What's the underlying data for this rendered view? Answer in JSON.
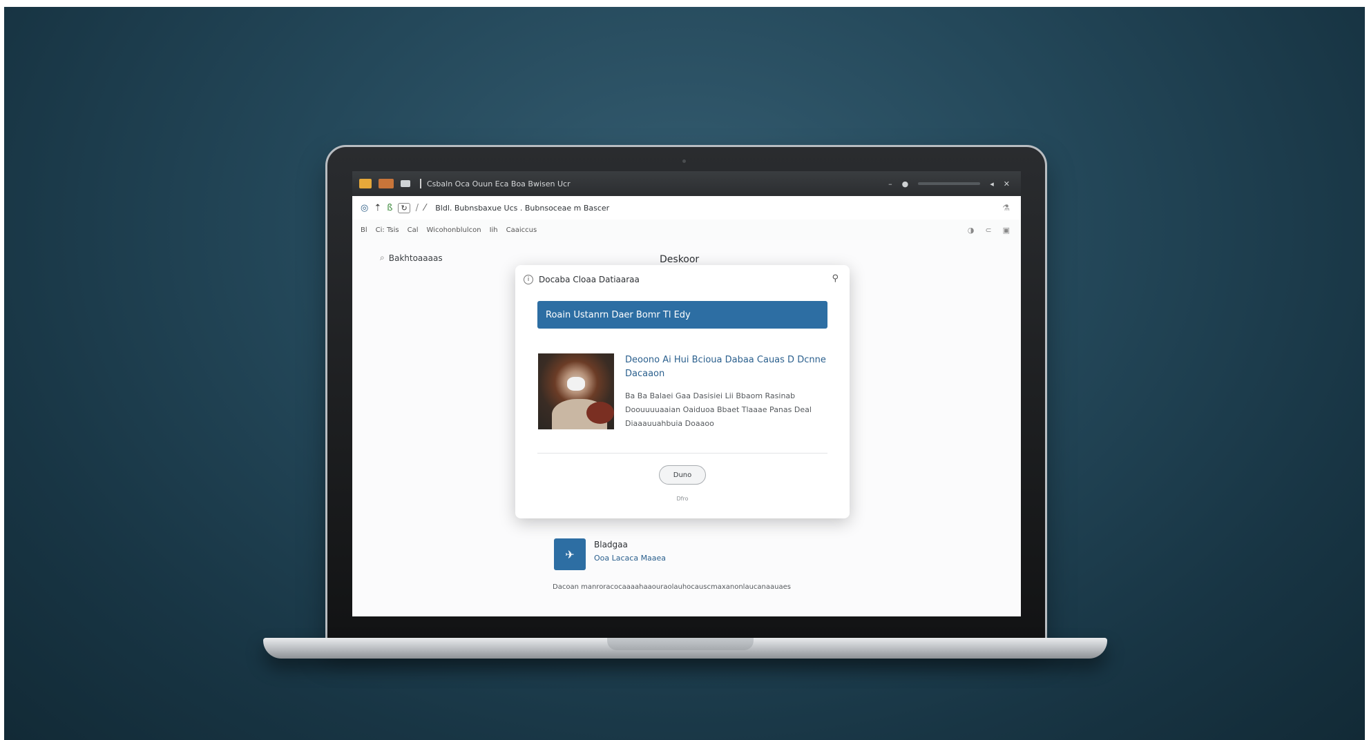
{
  "window": {
    "title": "Csbaln Oca Ouun Eca Boa Bwisen Ucr",
    "window_controls": [
      "–",
      "●",
      "▭",
      "◂",
      "✕"
    ]
  },
  "address_bar": {
    "url": "Bldl. Bubnsbaxue Ucs . Bubnsoceae m Bascer",
    "right_icon": "⚗"
  },
  "bookmarks": {
    "items": [
      "Bl",
      "Ci: Tsis",
      "Cal",
      "Wicohonblulcon",
      "Iih",
      "Caaiccus"
    ],
    "right_icons": [
      "◑",
      "⊂",
      "▣"
    ]
  },
  "page": {
    "side_link": "Bakhtoaaaas",
    "heading": "Deskoor"
  },
  "dialog": {
    "header": "Docaba Cloaa Datiaaraa",
    "close_icon": "⚲",
    "banner": "Roain Ustanrn Daer Bomr Tl Edy",
    "article_title": "Deoono Ai Hui Bcioua Dabaa Cauas D Dcnne Dacaaon",
    "article_body": "Ba Ba Balaei Gaa Dasisiei Lii Bbaom Rasinab Doouuuuaaian Oaiduoa Bbaet Tlaaae Panas Deal Diaaauuahbuia Doaaoo",
    "button": "Duno",
    "footnote": "Dfro"
  },
  "app": {
    "name": "Bladgaa",
    "link": "Ooa Lacaca Maaea",
    "tile_icon": "✈"
  },
  "footer": {
    "text": "Dacoan manroracocaaaahaaouraolauhocauscmaxanonlaucanaauaes"
  }
}
